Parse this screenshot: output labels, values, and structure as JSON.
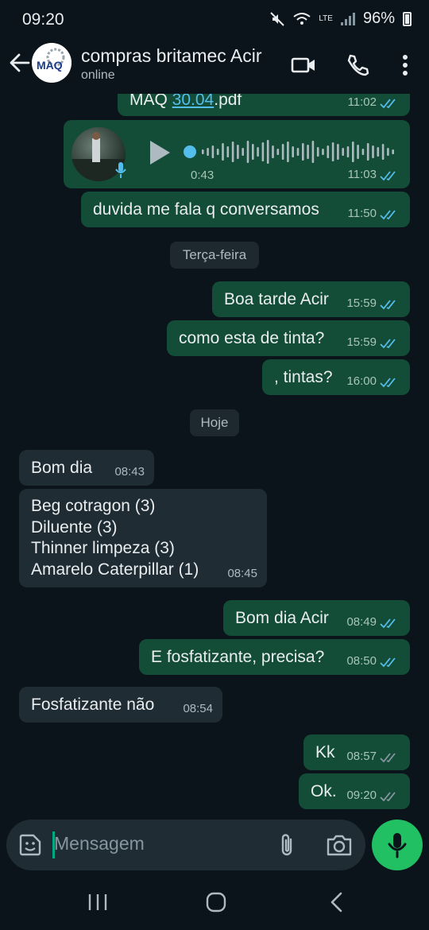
{
  "status_bar": {
    "time": "09:20",
    "network": "LTE",
    "battery": "96%"
  },
  "header": {
    "contact_name": "compras britamec Acir",
    "contact_status": "online",
    "avatar_text": "MAQ"
  },
  "messages": [
    {
      "text": "MAQ ",
      "link": "30.04",
      "suffix": ".pdf",
      "time": "11:02",
      "direction": "outgoing",
      "status": "read"
    },
    {
      "type": "voice",
      "duration": "0:43",
      "time": "11:03",
      "direction": "outgoing",
      "status": "read"
    },
    {
      "text": "duvida me fala q conversamos",
      "time": "11:50",
      "direction": "outgoing",
      "status": "read"
    },
    {
      "text": "Boa tarde Acir",
      "time": "15:59",
      "direction": "outgoing",
      "status": "read"
    },
    {
      "text": "como esta de tinta?",
      "time": "15:59",
      "direction": "outgoing",
      "status": "read"
    },
    {
      "text": ", tintas?",
      "time": "16:00",
      "direction": "outgoing",
      "status": "read"
    },
    {
      "text": "Bom dia",
      "time": "08:43",
      "direction": "incoming"
    },
    {
      "lines": [
        "Beg cotragon (3)",
        "Diluente (3)",
        "Thinner limpeza (3)",
        "Amarelo Caterpillar (1)"
      ],
      "time": "08:45",
      "direction": "incoming"
    },
    {
      "text": "Bom dia Acir",
      "time": "08:49",
      "direction": "outgoing",
      "status": "read"
    },
    {
      "text": "E fosfatizante, precisa?",
      "time": "08:50",
      "direction": "outgoing",
      "status": "read"
    },
    {
      "text": "Fosfatizante não",
      "time": "08:54",
      "direction": "incoming"
    },
    {
      "text": "Kk",
      "time": "08:57",
      "direction": "outgoing",
      "status": "delivered"
    },
    {
      "text": "Ok.",
      "time": "09:20",
      "direction": "outgoing",
      "status": "delivered"
    }
  ],
  "date_separators": [
    "Terça-feira",
    "Hoje"
  ],
  "input": {
    "placeholder": "Mensagem"
  },
  "colors": {
    "read_ticks": "#53bdeb",
    "delivered_ticks": "#8696a0",
    "outgoing_bubble": "#144d37",
    "incoming_bubble": "#1f2c33",
    "accent": "#21c063"
  }
}
